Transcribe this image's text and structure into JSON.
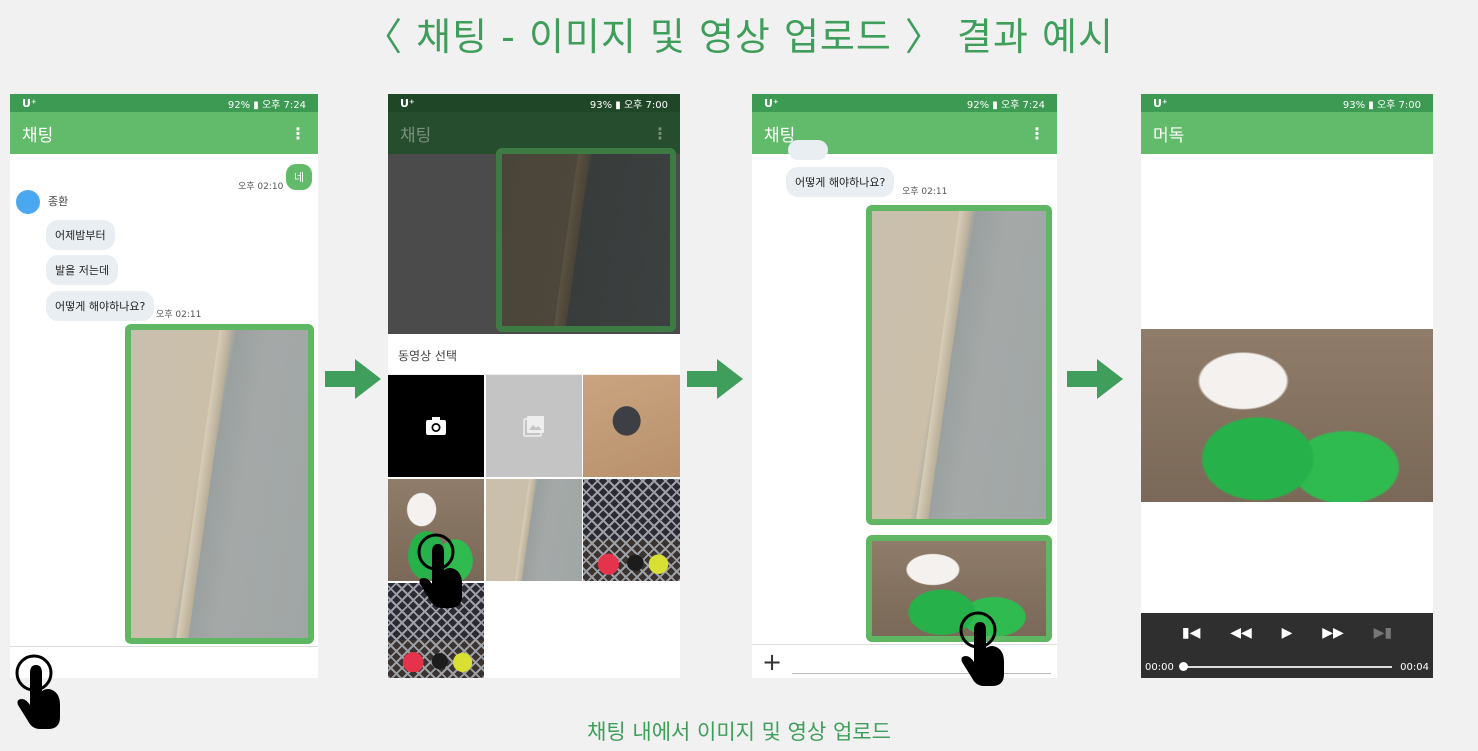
{
  "title": "〈 채팅 - 이미지 및 영상 업로드 〉 결과 예시",
  "caption": "채팅 내에서 이미지 및 영상 업로드",
  "colors": {
    "accent": "#3f9e5c",
    "appbar": "#62bb6a",
    "statusbar": "#3d9a52",
    "frame": "#5fb764"
  },
  "screen1": {
    "status": {
      "carrier": "U⁺",
      "right": "92% ▮ 오후 7:24"
    },
    "appbar_title": "채팅",
    "more_icon": "⋮",
    "my_message": "네",
    "my_time": "오후 02:10",
    "sender_name": "종환",
    "messages": [
      "어제밤부터",
      "발을 저는데",
      "어떻게 해야하나요?"
    ],
    "last_time": "오후 02:11"
  },
  "screen2": {
    "status": {
      "carrier": "U⁺",
      "right": "93% ▮ 오후 7:00"
    },
    "appbar_title": "채팅",
    "more_icon": "⋮",
    "picker_label": "동영상 선택"
  },
  "screen3": {
    "status": {
      "carrier": "U⁺",
      "right": "92% ▮ 오후 7:24"
    },
    "appbar_title": "채팅",
    "more_icon": "⋮",
    "message": "어떻게 해야하나요?",
    "time": "오후 02:11",
    "plus_icon": "+"
  },
  "screen4": {
    "status": {
      "carrier": "U⁺",
      "right": "93% ▮ 오후 7:00"
    },
    "appbar_title": "머독",
    "current_time": "00:00",
    "duration": "00:04",
    "progress": 0
  },
  "icons": [
    "arrow-right-icon",
    "pointing-hand-icon",
    "camera-icon",
    "gallery-icon",
    "skip-previous-icon",
    "rewind-icon",
    "play-icon",
    "fast-forward-icon",
    "skip-next-icon"
  ]
}
